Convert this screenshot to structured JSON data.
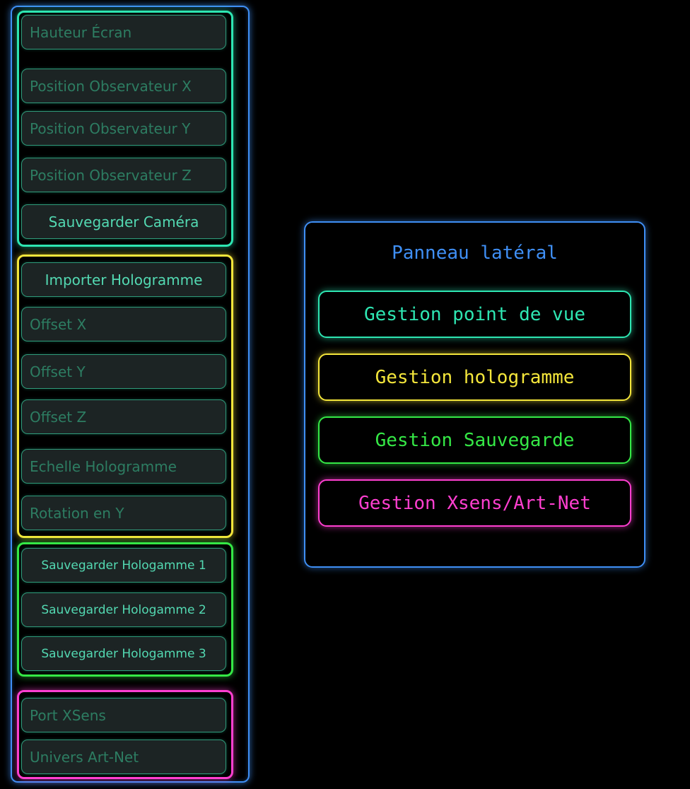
{
  "sidebar": {
    "view_group": {
      "screen_height_placeholder": "Hauteur Écran",
      "observer_x_placeholder": "Position Observateur X",
      "observer_y_placeholder": "Position Observateur Y",
      "observer_z_placeholder": "Position Observateur Z",
      "save_camera_label": "Sauvegarder Caméra"
    },
    "hologram_group": {
      "import_label": "Importer Hologramme",
      "offset_x_placeholder": "Offset X",
      "offset_y_placeholder": "Offset Y",
      "offset_z_placeholder": "Offset Z",
      "scale_placeholder": "Echelle Hologramme",
      "rotation_y_placeholder": "Rotation en Y"
    },
    "save_group": {
      "save_1_label": "Sauvegarder Hologamme 1",
      "save_2_label": "Sauvegarder Hologamme 2",
      "save_3_label": "Sauvegarder Hologamme 3"
    },
    "xsens_group": {
      "port_placeholder": "Port XSens",
      "universe_placeholder": "Univers Art-Net"
    }
  },
  "panel": {
    "title": "Panneau latéral",
    "buttons": {
      "view": "Gestion point de vue",
      "hologram": "Gestion hologramme",
      "save": "Gestion Sauvegarde",
      "xsens": "Gestion Xsens/Art-Net"
    }
  },
  "colors": {
    "blue": "#3f8ff5",
    "teal": "#2ee6b2",
    "yellow": "#f4e63b",
    "green": "#35e846",
    "pink": "#ff3fd0"
  }
}
